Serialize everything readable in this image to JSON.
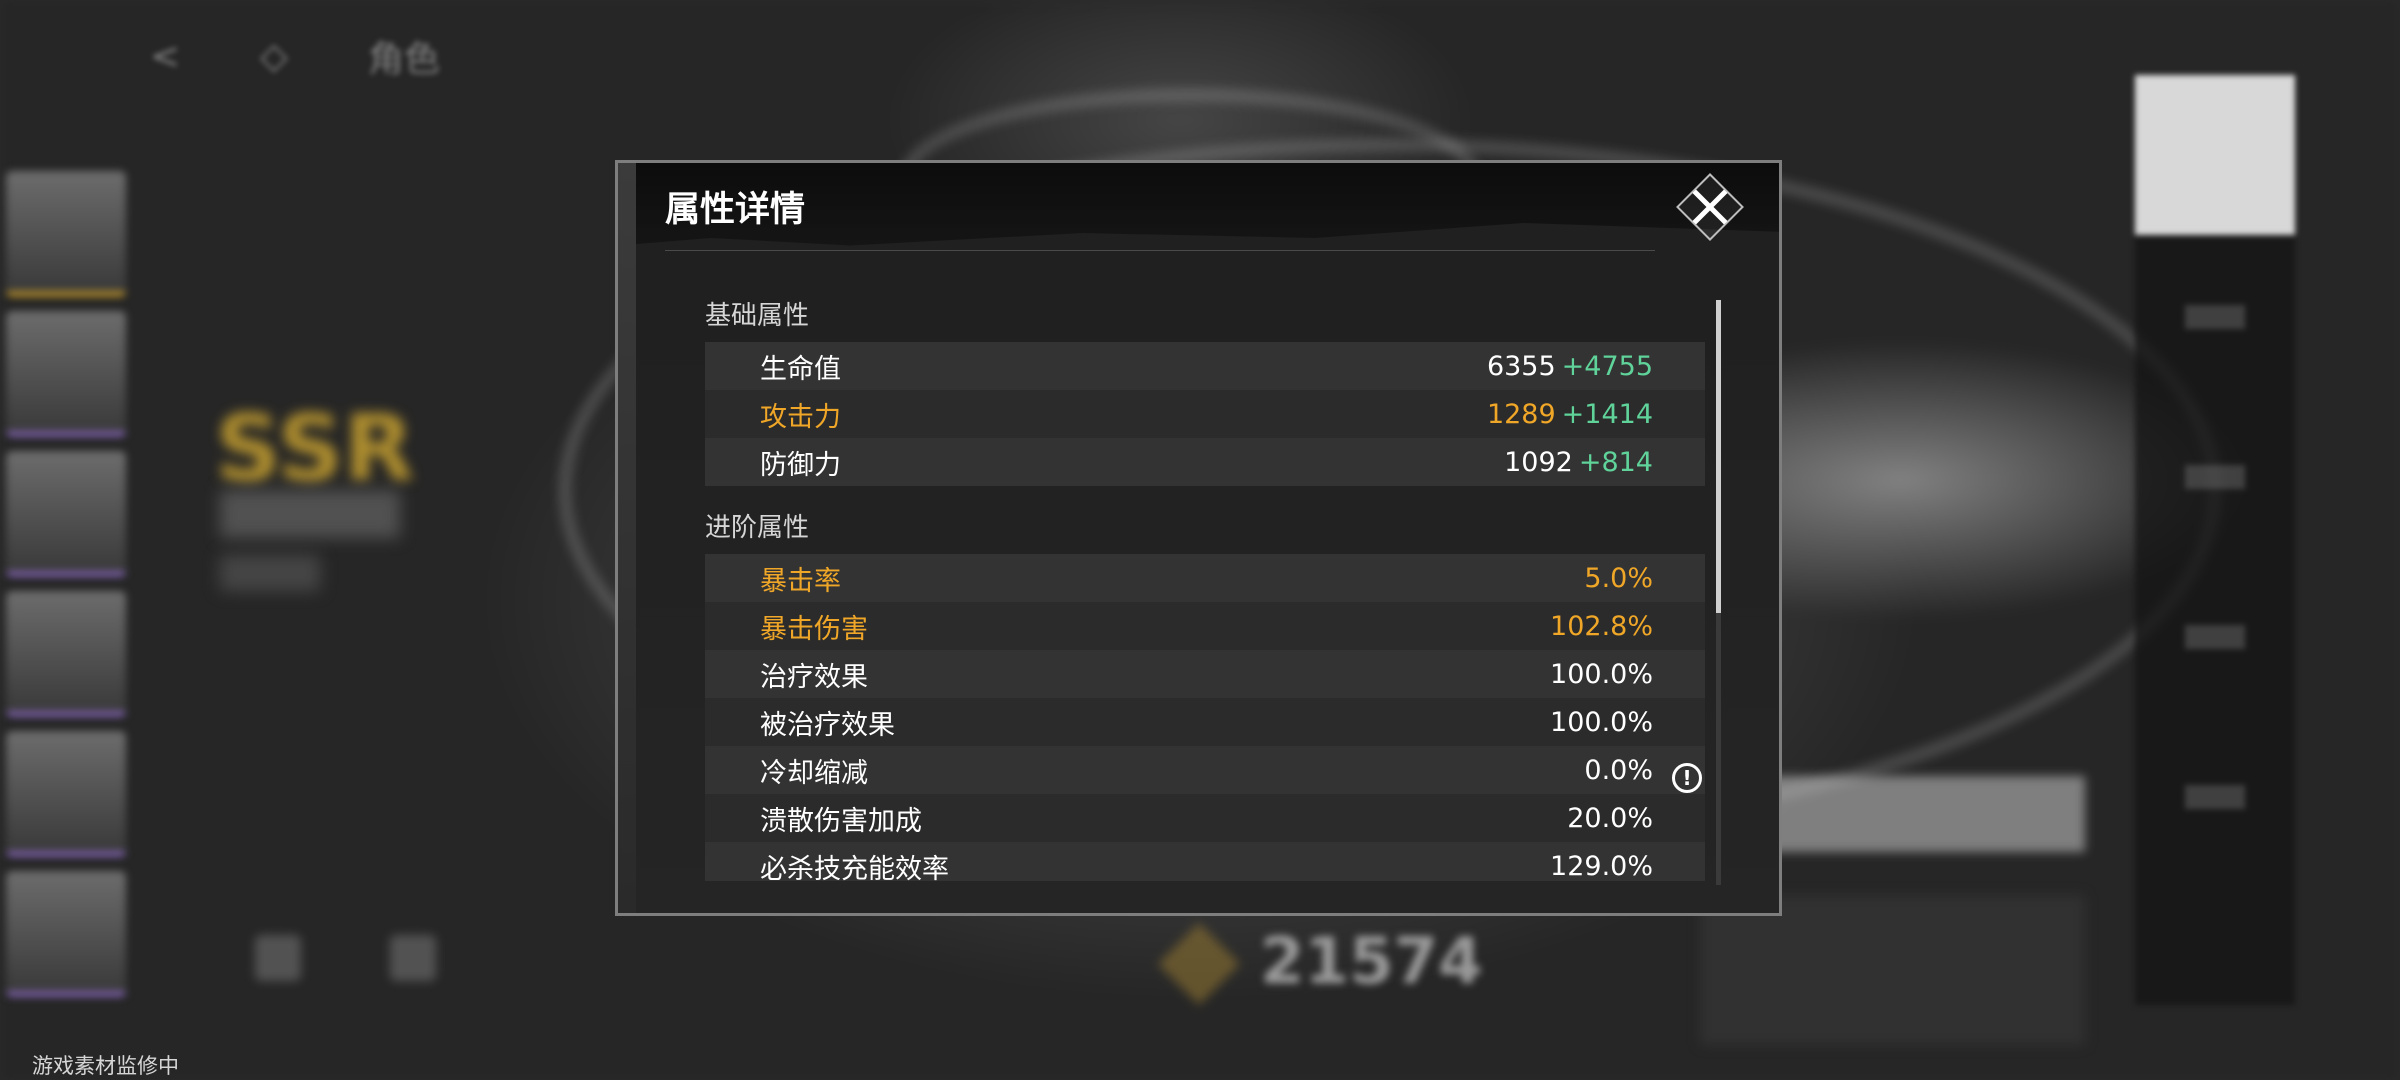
{
  "background": {
    "top_bar": [
      "<",
      "◇",
      "角色"
    ],
    "power_value": "21574",
    "rarity_badge": "SSR"
  },
  "watermark": "游戏素材监修中",
  "modal": {
    "title": "属性详情",
    "close_icon": "close-icon",
    "sections": [
      {
        "title": "基础属性",
        "rows": [
          {
            "label": "生命值",
            "value": "6355",
            "bonus": "+4755",
            "color": "#ffffff"
          },
          {
            "label": "攻击力",
            "value": "1289",
            "bonus": "+1414",
            "color": "#f0a728"
          },
          {
            "label": "防御力",
            "value": "1092",
            "bonus": "+814",
            "color": "#ffffff"
          }
        ]
      },
      {
        "title": "进阶属性",
        "rows": [
          {
            "label": "暴击率",
            "value": "5.0%",
            "color": "#f0a728"
          },
          {
            "label": "暴击伤害",
            "value": "102.8%",
            "color": "#f0a728",
            "info_icon": "info-icon"
          },
          {
            "label": "治疗效果",
            "value": "100.0%",
            "color": "#ffffff"
          },
          {
            "label": "被治疗效果",
            "value": "100.0%",
            "color": "#ffffff"
          },
          {
            "label": "冷却缩减",
            "value": "0.0%",
            "color": "#ffffff"
          },
          {
            "label": "溃散伤害加成",
            "value": "20.0%",
            "color": "#ffffff"
          },
          {
            "label": "必杀技充能效率",
            "value": "129.0%",
            "color": "#ffffff"
          }
        ]
      }
    ],
    "colors": {
      "bonus": "#5fd39a",
      "highlight": "#f0a728"
    }
  }
}
